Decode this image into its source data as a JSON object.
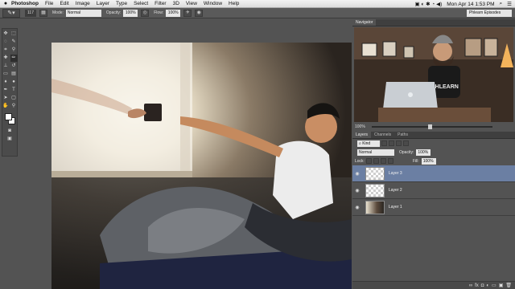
{
  "menubar": {
    "apple": "",
    "app_name": "Photoshop",
    "items": [
      "File",
      "Edit",
      "Image",
      "Layer",
      "Type",
      "Select",
      "Filter",
      "3D",
      "View",
      "Window",
      "Help"
    ],
    "clock": "Mon Apr 14  1:53 PM"
  },
  "options": {
    "brush_size": "117",
    "mode_label": "Mode:",
    "mode_value": "Normal",
    "opacity_label": "Opacity:",
    "opacity_value": "100%",
    "flow_label": "Flow:",
    "flow_value": "100%",
    "workspace": "Phlearn Episodes"
  },
  "navigator": {
    "tab": "Navigator",
    "zoom": "100%"
  },
  "layers": {
    "tabs": [
      "Layers",
      "Channels",
      "Paths"
    ],
    "kind_label": "Kind",
    "blend_mode": "Normal",
    "opacity_label": "Opacity:",
    "opacity_value": "100%",
    "lock_label": "Lock:",
    "fill_label": "Fill:",
    "fill_value": "100%",
    "items": [
      {
        "name": "Layer 3",
        "selected": true
      },
      {
        "name": "Layer 2",
        "selected": false
      },
      {
        "name": "Layer 1",
        "selected": false
      }
    ]
  },
  "video_overlay": {
    "shirt_text": "PHLEARN"
  },
  "colors": {
    "selection": "#6b7fa3",
    "ui_gray": "#535353"
  }
}
